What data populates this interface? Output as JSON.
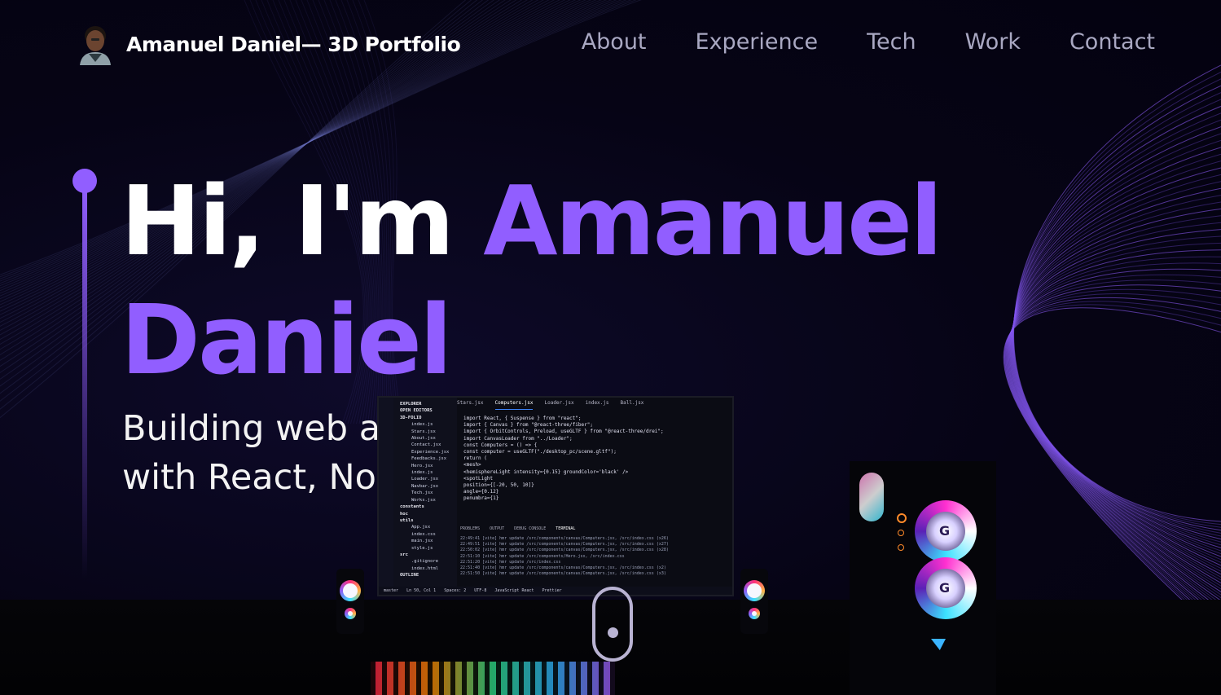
{
  "nav": {
    "brand_title": "Amanuel Daniel— 3D Portfolio",
    "links": [
      "About",
      "Experience",
      "Tech",
      "Work",
      "Contact"
    ]
  },
  "hero": {
    "greeting": "Hi, I'm ",
    "first_name": "Amanuel",
    "last_name": "Daniel",
    "subtitle_line1": "Building web a",
    "subtitle_line2": "with React, No",
    "accent_color": "#915EFF"
  },
  "editor": {
    "tabs": [
      "Stars.jsx",
      "Computers.jsx",
      "Loader.jsx",
      "index.js",
      "Ball.jsx"
    ],
    "active_tab": "Computers.jsx",
    "explorer": [
      "EXPLORER",
      "OPEN EDITORS",
      "3D-FOLIO",
      "index.js",
      "Stars.jsx",
      "About.jsx",
      "Contact.jsx",
      "Experience.jsx",
      "Feedbacks.jsx",
      "Hero.jsx",
      "index.js",
      "Loader.jsx",
      "Navbar.jsx",
      "Tech.jsx",
      "Works.jsx",
      "constants",
      "hoc",
      "utils",
      "App.jsx",
      "index.css",
      "main.jsx",
      "style.js",
      "src",
      ".gitignore",
      "index.html",
      "OUTLINE"
    ],
    "code_lines": [
      "import React, { Suspense } from \"react\";",
      "import { Canvas } from \"@react-three/fiber\";",
      "import { OrbitControls, Preload, useGLTF } from \"@react-three/drei\";",
      "",
      "import CanvasLoader from \"../Loader\";",
      "",
      "const Computers = () => {",
      "  const computer = useGLTF(\"./desktop_pc/scene.gltf\");",
      "",
      "  return (",
      "    <mesh>",
      "      <hemisphereLight intensity={0.15} groundColor='black' />",
      "      <spotLight",
      "        position={[-20, 50, 10]}",
      "        angle={0.12}",
      "        penumbra={1}"
    ],
    "terminal_tabs": [
      "PROBLEMS",
      "OUTPUT",
      "DEBUG CONSOLE",
      "TERMINAL"
    ],
    "terminal_lines": [
      "22:49:41 [vite] hmr update /src/components/canvas/Computers.jsx, /src/index.css (x26)",
      "22:49:51 [vite] hmr update /src/components/canvas/Computers.jsx, /src/index.css (x27)",
      "22:50:02 [vite] hmr update /src/components/canvas/Computers.jsx, /src/index.css (x28)",
      "22:51:10 [vite] hmr update /src/components/Hero.jsx, /src/index.css",
      "22:51:20 [vite] hmr update /src/index.css",
      "22:51:40 [vite] hmr update /src/components/canvas/Computers.jsx, /src/index.css (x2)",
      "22:51:50 [vite] hmr update /src/components/canvas/Computers.jsx, /src/index.css (x3)"
    ],
    "status_items": [
      "master",
      "Ln 50, Col 1",
      "Spaces: 2",
      "UTF-8",
      "JavaScript React",
      "Prettier"
    ]
  },
  "icons": {
    "scroll": "scroll-mouse-icon",
    "avatar": "avatar-image"
  }
}
